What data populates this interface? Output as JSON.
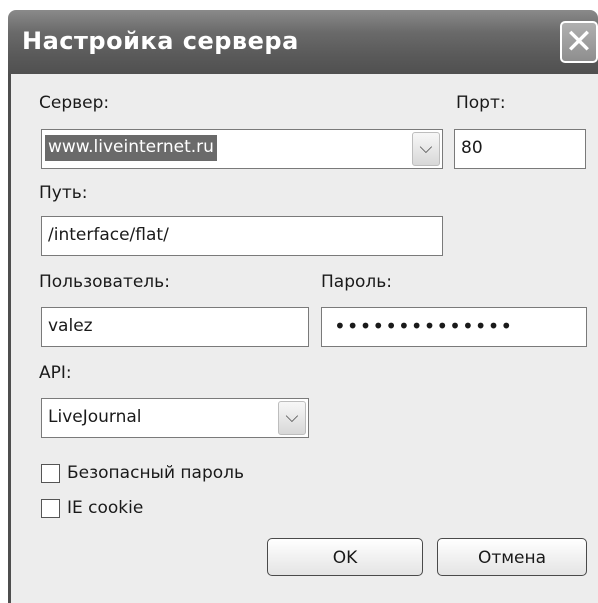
{
  "window": {
    "title": "Настройка сервера"
  },
  "form": {
    "server": {
      "label": "Сервер:",
      "value": "www.liveinternet.ru"
    },
    "port": {
      "label": "Порт:",
      "value": "80"
    },
    "path": {
      "label": "Путь:",
      "value": "/interface/flat/"
    },
    "user": {
      "label": "Пользователь:",
      "value": "valez"
    },
    "password": {
      "label": "Пароль:",
      "value": "••••••••••••••"
    },
    "api": {
      "label": "API:",
      "value": "LiveJournal"
    },
    "secure_password": {
      "label": "Безопасный пароль",
      "checked": false
    },
    "ie_cookie": {
      "label": "IE cookie",
      "checked": false
    }
  },
  "buttons": {
    "ok": "OK",
    "cancel": "Отмена"
  },
  "icons": {
    "close": "close-icon",
    "dropdown": "chevron-down-icon"
  }
}
